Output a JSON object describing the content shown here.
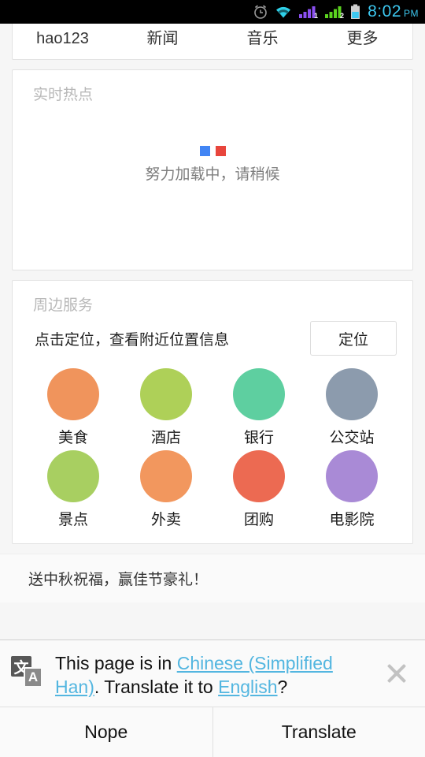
{
  "statusbar": {
    "time": "8:02",
    "ampm": "PM",
    "icons": [
      "alarm-clock-icon",
      "wifi-icon",
      "signal-1-icon",
      "signal-2-icon",
      "battery-icon"
    ],
    "sim1_label": "1",
    "sim2_label": "2",
    "time_color": "#3dc8f0",
    "wifi_color": "#2fd0e8",
    "signal1_color": "#8a4ff0",
    "signal2_color": "#5bd41f",
    "battery_color": "#3dc8f0"
  },
  "nav": {
    "items": [
      {
        "label": "hao123"
      },
      {
        "label": "新闻"
      },
      {
        "label": "音乐"
      },
      {
        "label": "更多"
      }
    ]
  },
  "hot_card": {
    "title": "实时热点",
    "loading_text": "努力加载中，请稍候",
    "spinner_colors": [
      "#4285f4",
      "#e8453c"
    ]
  },
  "nearby_card": {
    "title": "周边服务",
    "prompt": "点击定位，查看附近位置信息",
    "locate_button": "定位",
    "tiles": [
      {
        "label": "美食",
        "color": "#f0945c"
      },
      {
        "label": "酒店",
        "color": "#aed058"
      },
      {
        "label": "银行",
        "color": "#5ecfa0"
      },
      {
        "label": "公交站",
        "color": "#8c9bad"
      },
      {
        "label": "景点",
        "color": "#a8cf61"
      },
      {
        "label": "外卖",
        "color": "#f2975e"
      },
      {
        "label": "团购",
        "color": "#ec6a52"
      },
      {
        "label": "电影院",
        "color": "#a98ad6"
      }
    ]
  },
  "promo": {
    "text": "送中秋祝福，赢佳节豪礼！"
  },
  "infobar": {
    "icon_top_glyph": "文",
    "icon_bottom_glyph": "A",
    "message_prefix": "This page is in ",
    "source_language": "Chinese (Simplified Han)",
    "message_middle": ". Translate it to ",
    "target_language": "English",
    "message_suffix": "?",
    "link_color": "#53b6e0",
    "close_label": "close-icon",
    "decline_button": "Nope",
    "accept_button": "Translate"
  }
}
